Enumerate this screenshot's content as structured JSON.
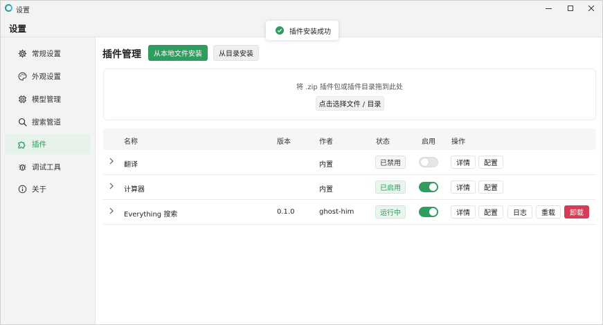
{
  "window": {
    "title": "设置",
    "header": "设置"
  },
  "toast": {
    "message": "插件安装成功",
    "icon": "check-circle-icon"
  },
  "sidebar": {
    "items": [
      {
        "label": "常规设置",
        "icon": "gear-icon",
        "active": false
      },
      {
        "label": "外观设置",
        "icon": "palette-icon",
        "active": false
      },
      {
        "label": "模型管理",
        "icon": "chip-icon",
        "active": false
      },
      {
        "label": "搜索管道",
        "icon": "search-icon",
        "active": false
      },
      {
        "label": "插件",
        "icon": "puzzle-icon",
        "active": true
      },
      {
        "label": "调试工具",
        "icon": "bug-icon",
        "active": false
      },
      {
        "label": "关于",
        "icon": "info-icon",
        "active": false
      }
    ]
  },
  "main": {
    "title": "插件管理",
    "install_local": "从本地文件安装",
    "install_dir": "从目录安装",
    "dropzone_hint": "将 .zip 插件包或插件目录拖到此处",
    "choose_button": "点击选择文件 / 目录"
  },
  "table": {
    "columns": [
      "名称",
      "版本",
      "作者",
      "状态",
      "启用",
      "操作"
    ],
    "rows": [
      {
        "name": "翻译",
        "version": "",
        "author": "内置",
        "status": "已禁用",
        "status_kind": "disabled",
        "enabled": false,
        "actions": [
          "详情",
          "配置"
        ]
      },
      {
        "name": "计算器",
        "version": "",
        "author": "内置",
        "status": "已启用",
        "status_kind": "enabled",
        "enabled": true,
        "actions": [
          "详情",
          "配置"
        ]
      },
      {
        "name": "Everything 搜索",
        "version": "0.1.0",
        "author": "ghost-him",
        "status": "运行中",
        "status_kind": "running",
        "enabled": true,
        "actions": [
          "详情",
          "配置",
          "日志",
          "重载",
          "卸载"
        ]
      }
    ]
  },
  "colors": {
    "accent": "#2e9e5e",
    "danger": "#d63c57"
  }
}
